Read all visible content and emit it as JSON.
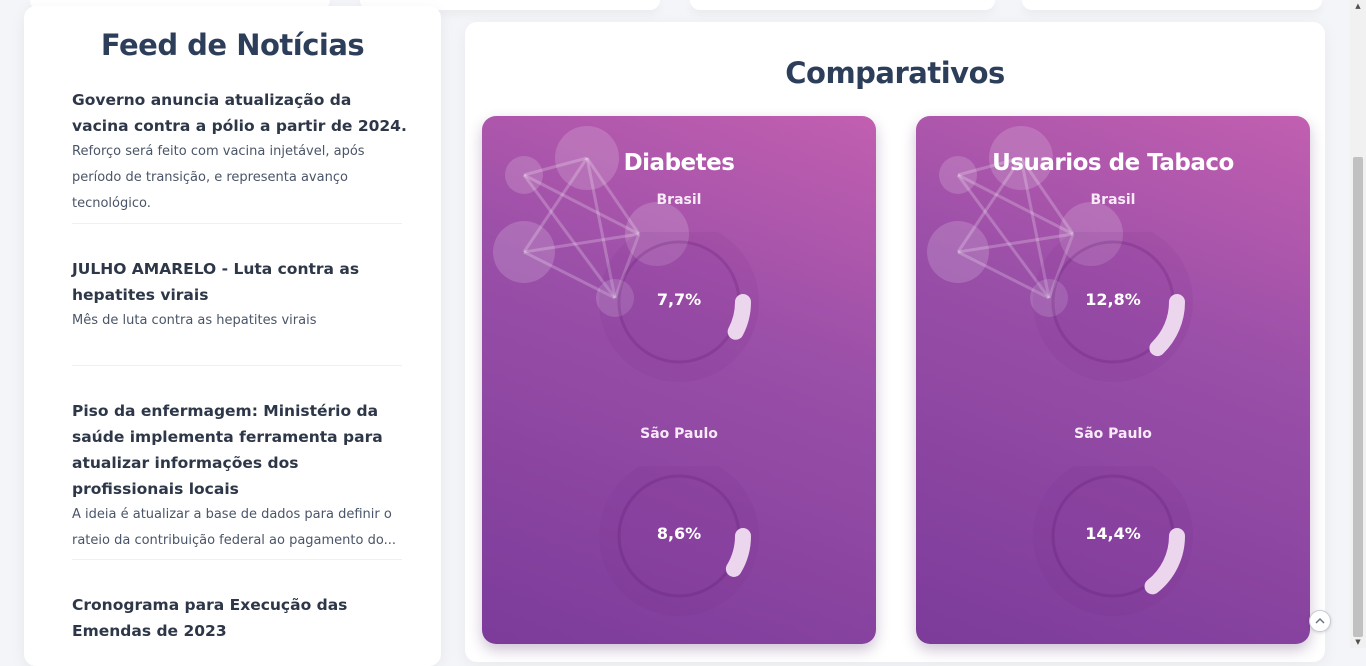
{
  "news": {
    "title": "Feed de Notícias",
    "items": [
      {
        "headline": "Governo anuncia atualização da vacina contra a pólio a partir de 2024.",
        "summary": "Reforço será feito com vacina injetável, após período de transição, e representa avanço tecnológico."
      },
      {
        "headline": "JULHO AMARELO - Luta contra as hepatites virais",
        "summary": "Mês de luta contra as hepatites virais"
      },
      {
        "headline": "Piso da enfermagem: Ministério da saúde implementa ferramenta para atualizar informações dos profissionais locais",
        "summary": "A ideia é atualizar a base de dados para definir o rateio da contribuição federal ao pagamento do..."
      },
      {
        "headline": "Cronograma para Execução das Emendas de 2023",
        "summary": ""
      }
    ]
  },
  "comparativos": {
    "title": "Comparativos",
    "cards": [
      {
        "title": "Diabetes",
        "metrics": [
          {
            "region": "Brasil",
            "value_label": "7,7%",
            "value": 7.7
          },
          {
            "region": "São Paulo",
            "value_label": "8,6%",
            "value": 8.6
          }
        ]
      },
      {
        "title": "Usuarios de Tabaco",
        "metrics": [
          {
            "region": "Brasil",
            "value_label": "12,8%",
            "value": 12.8
          },
          {
            "region": "São Paulo",
            "value_label": "14,4%",
            "value": 14.4
          }
        ]
      }
    ]
  },
  "colors": {
    "heading": "#2d3e5b",
    "card_gradient_start": "#c25fb0",
    "card_gradient_end": "#7c3b9a",
    "gauge_arc": "#ecd6ee"
  },
  "icons": {
    "back_to_top": "chevron-up-icon"
  }
}
